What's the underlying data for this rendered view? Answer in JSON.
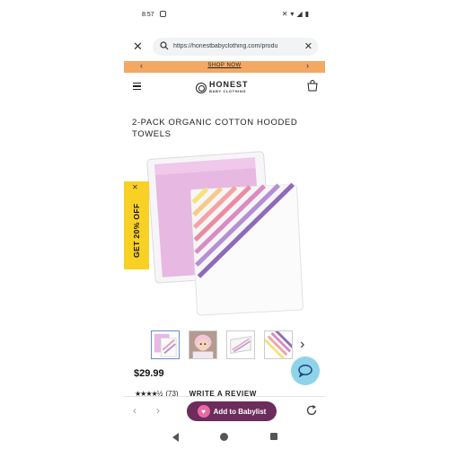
{
  "status_bar": {
    "time": "8:57",
    "icons": [
      "mute-icon",
      "wifi-icon",
      "signal-icon",
      "battery-icon"
    ]
  },
  "browser": {
    "url": "https://honestbabyclothing.com/produ",
    "close_icon": "close-icon",
    "clear_icon": "clear-icon"
  },
  "promo": {
    "text": "SHOP NOW",
    "background": "#f3a864"
  },
  "header": {
    "logo_text": "HONEST",
    "logo_sub": "BABY CLOTHING"
  },
  "product": {
    "title": "2-PACK ORGANIC COTTON HOODED TOWELS",
    "price": "$29.99",
    "rating_count": "(73)",
    "write_review": "WRITE A REVIEW",
    "stars": "★★★★½",
    "rating_value": 4.5
  },
  "discount_tab": {
    "text": "GET 20% OFF",
    "background": "#f9d024"
  },
  "toolbar": {
    "babylist_label": "Add to Babylist",
    "babylist_color": "#6c2c5c"
  },
  "thumbnails": [
    "pink-towel",
    "baby-photo",
    "towel-folded",
    "rainbow-towel"
  ]
}
